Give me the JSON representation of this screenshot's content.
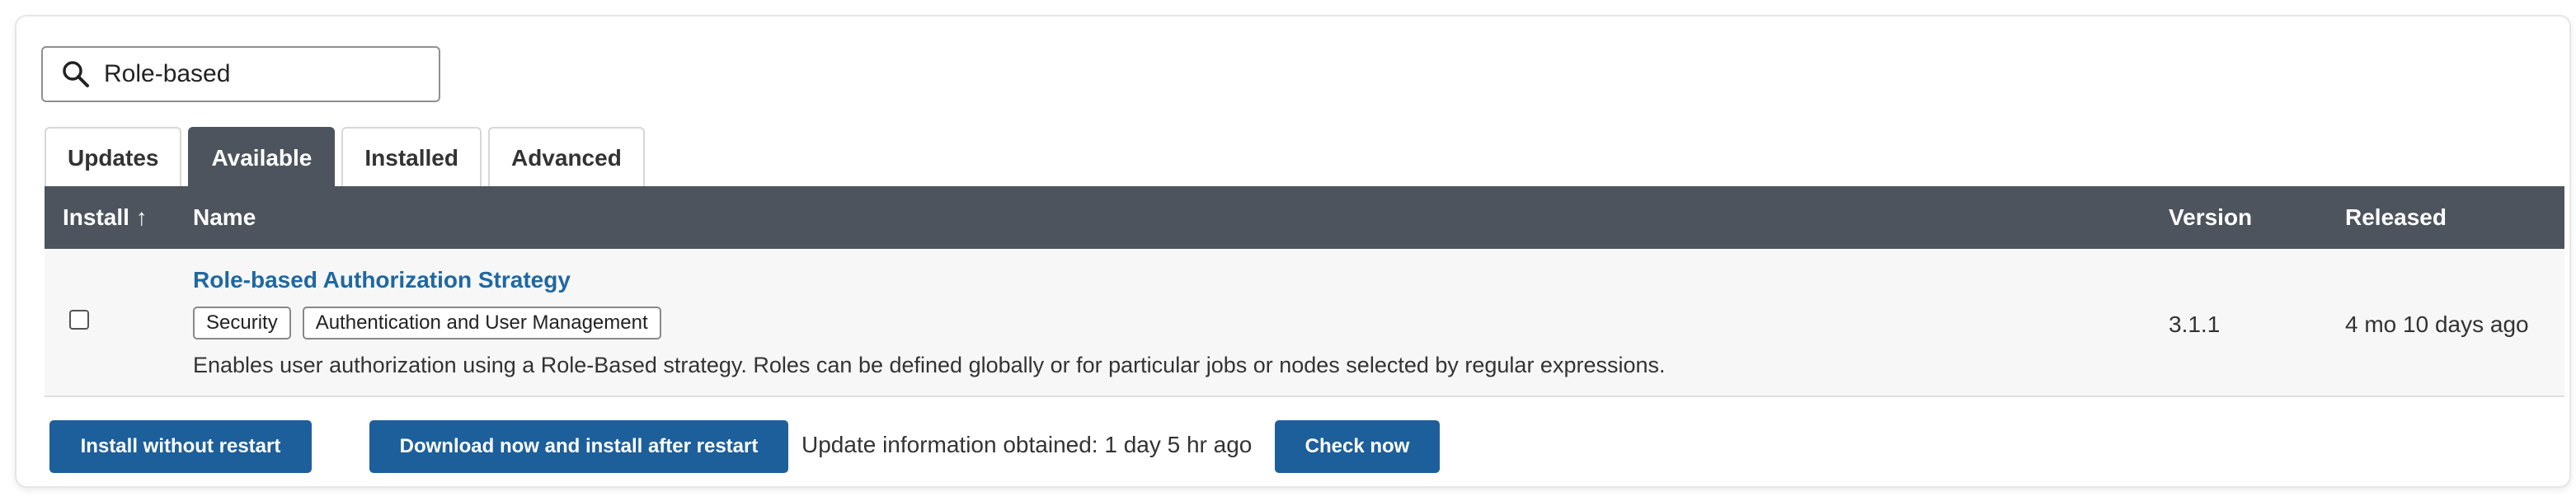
{
  "search": {
    "value": "Role-based",
    "icon": "search-icon"
  },
  "tabs": [
    {
      "label": "Updates",
      "active": false
    },
    {
      "label": "Available",
      "active": true
    },
    {
      "label": "Installed",
      "active": false
    },
    {
      "label": "Advanced",
      "active": false
    }
  ],
  "table": {
    "headers": {
      "install": "Install ↑",
      "name": "Name",
      "version": "Version",
      "released": "Released"
    },
    "rows": [
      {
        "checked": false,
        "name": "Role-based Authorization Strategy",
        "tags": [
          "Security",
          "Authentication and User Management"
        ],
        "description": "Enables user authorization using a Role-Based strategy. Roles can be defined globally or for particular jobs or nodes selected by regular expressions.",
        "version": "3.1.1",
        "released": "4 mo 10 days ago"
      }
    ]
  },
  "footer": {
    "install_without_restart": "Install without restart",
    "download_install_after_restart": "Download now and install after restart",
    "update_info": "Update information obtained: 1 day 5 hr ago",
    "check_now": "Check now"
  },
  "colors": {
    "header_bg": "#4d545d",
    "link": "#1f68a2",
    "button": "#1d5f9a",
    "row_bg": "#f7f7f7"
  }
}
